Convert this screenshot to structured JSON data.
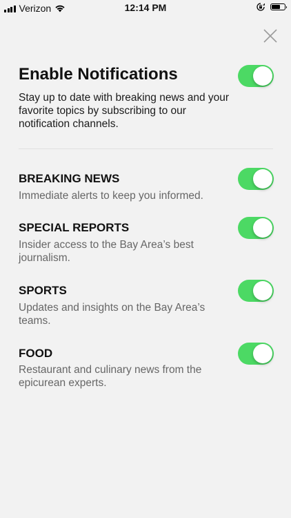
{
  "status_bar": {
    "carrier": "Verizon",
    "time": "12:14 PM",
    "battery_level": 0.65
  },
  "icons": {
    "signal": "signal-bars-icon",
    "wifi": "wifi-icon",
    "rotation_lock": "rotation-lock-icon",
    "battery": "battery-icon",
    "close": "close-icon"
  },
  "colors": {
    "toggle_on": "#4cd964",
    "background": "#f2f2f2",
    "description_text": "#666666"
  },
  "main": {
    "title": "Enable Notifications",
    "description": "Stay up to date with breaking news and your favorite topics by subscribing to our notification channels.",
    "enabled": true
  },
  "channels": [
    {
      "title": "BREAKING NEWS",
      "description": "Immediate alerts to keep you informed.",
      "enabled": true
    },
    {
      "title": "SPECIAL REPORTS",
      "description": "Insider access to the Bay Area’s best journalism.",
      "enabled": true
    },
    {
      "title": "SPORTS",
      "description": "Updates and insights on the Bay Area’s teams.",
      "enabled": true
    },
    {
      "title": "FOOD",
      "description": "Restaurant and culinary news from the epicurean experts.",
      "enabled": true
    }
  ]
}
